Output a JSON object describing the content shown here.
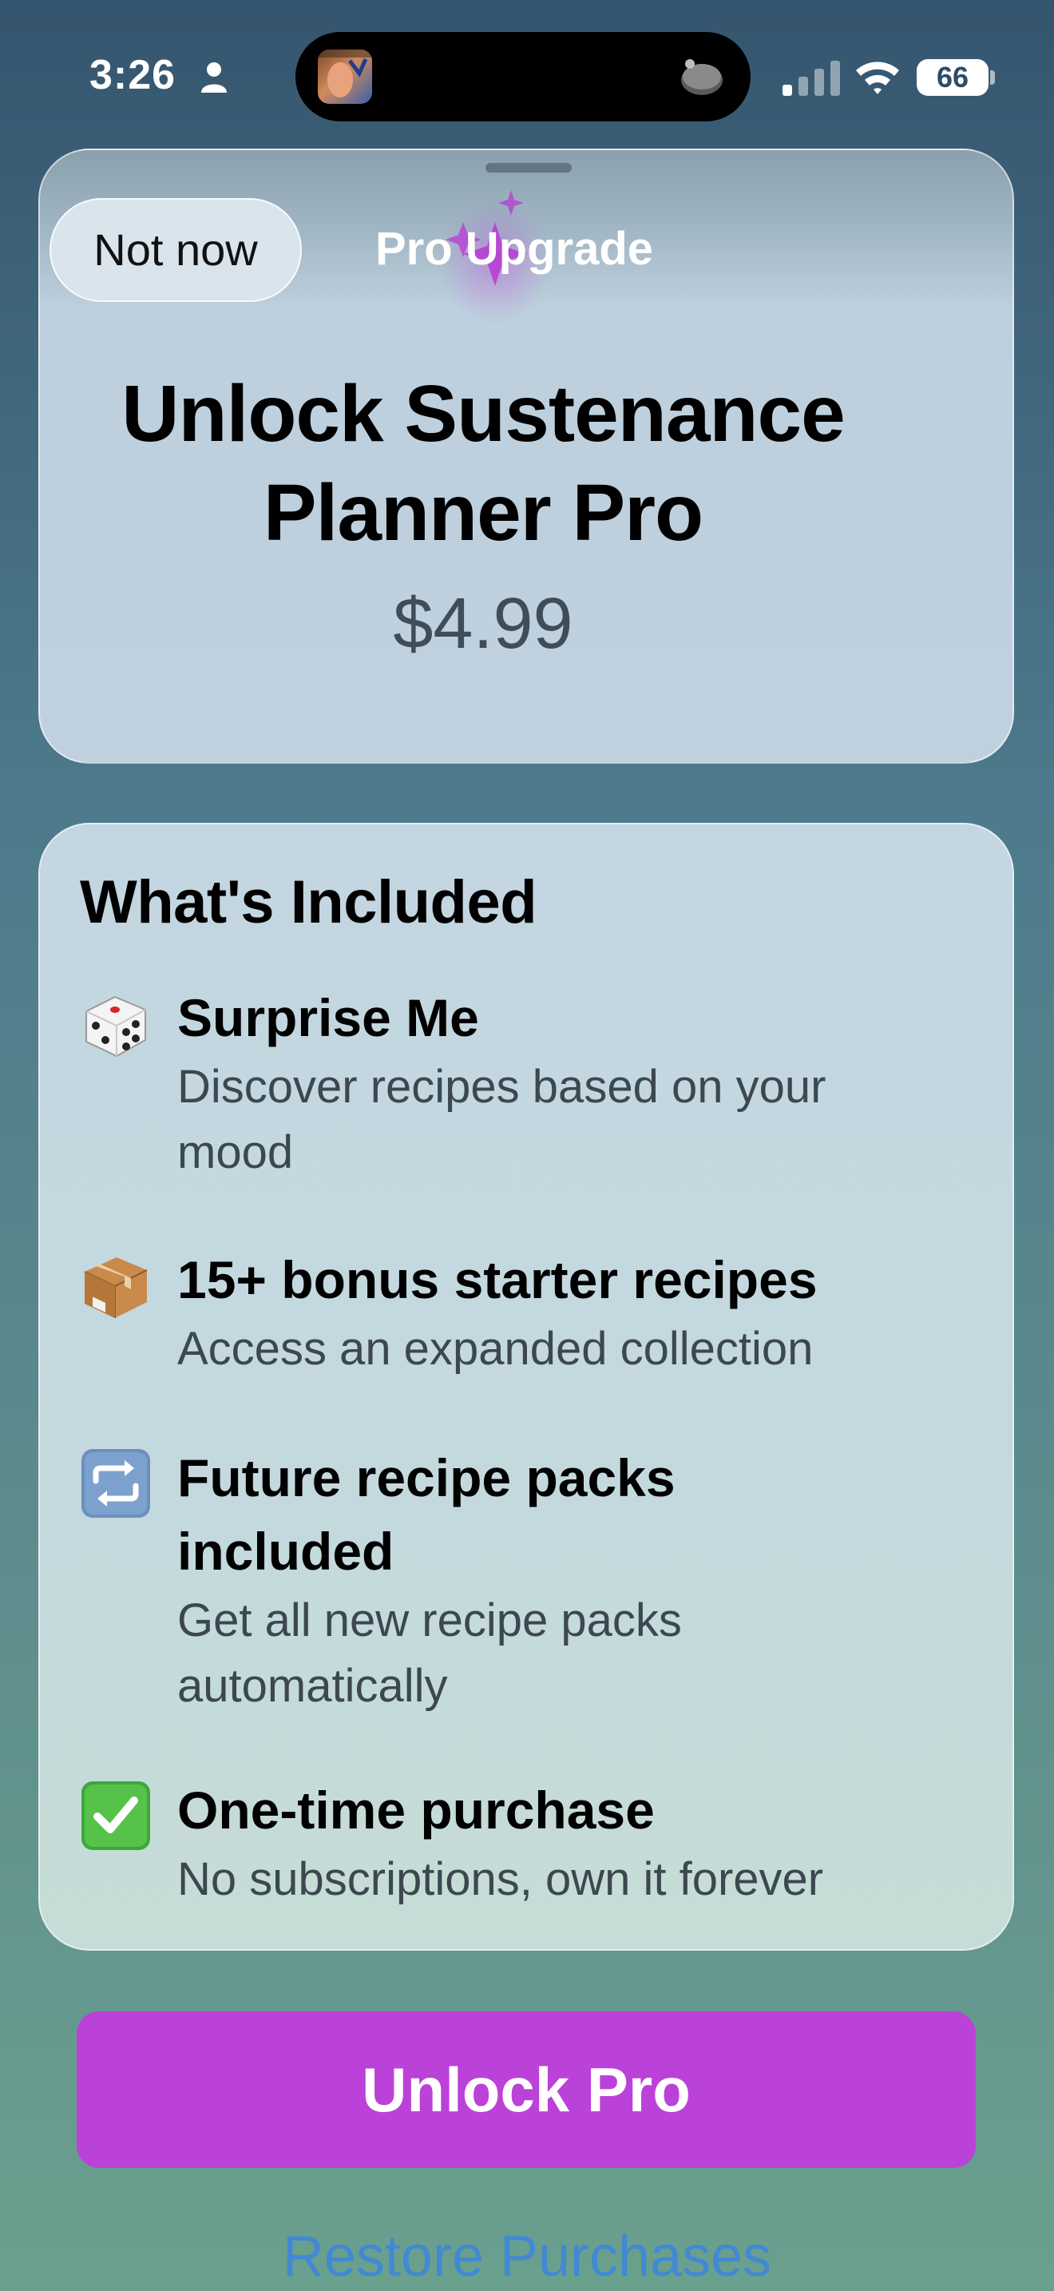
{
  "status_bar": {
    "time": "3:26",
    "battery": "66",
    "icons": [
      "person-icon",
      "signal-icon",
      "wifi-icon",
      "battery-icon"
    ]
  },
  "sheet": {
    "not_now_label": "Not now",
    "nav_title": "Pro Upgrade",
    "hero_title": "Unlock Sustenance Planner Pro",
    "price": "$4.99"
  },
  "included": {
    "title": "What's Included",
    "features": [
      {
        "icon": "dice-icon",
        "title": "Surprise Me",
        "description": "Discover recipes based on your mood"
      },
      {
        "icon": "package-icon",
        "title": "15+ bonus starter recipes",
        "description": "Access an expanded collection"
      },
      {
        "icon": "repeat-icon",
        "title": "Future recipe packs included",
        "description": "Get all new recipe packs automatically"
      },
      {
        "icon": "check-icon",
        "title": "One-time purchase",
        "description": "No subscriptions, own it forever"
      }
    ]
  },
  "actions": {
    "unlock_label": "Unlock Pro",
    "restore_label": "Restore Purchases"
  },
  "colors": {
    "accent": "#bb42d8",
    "link": "#3c86e0"
  }
}
